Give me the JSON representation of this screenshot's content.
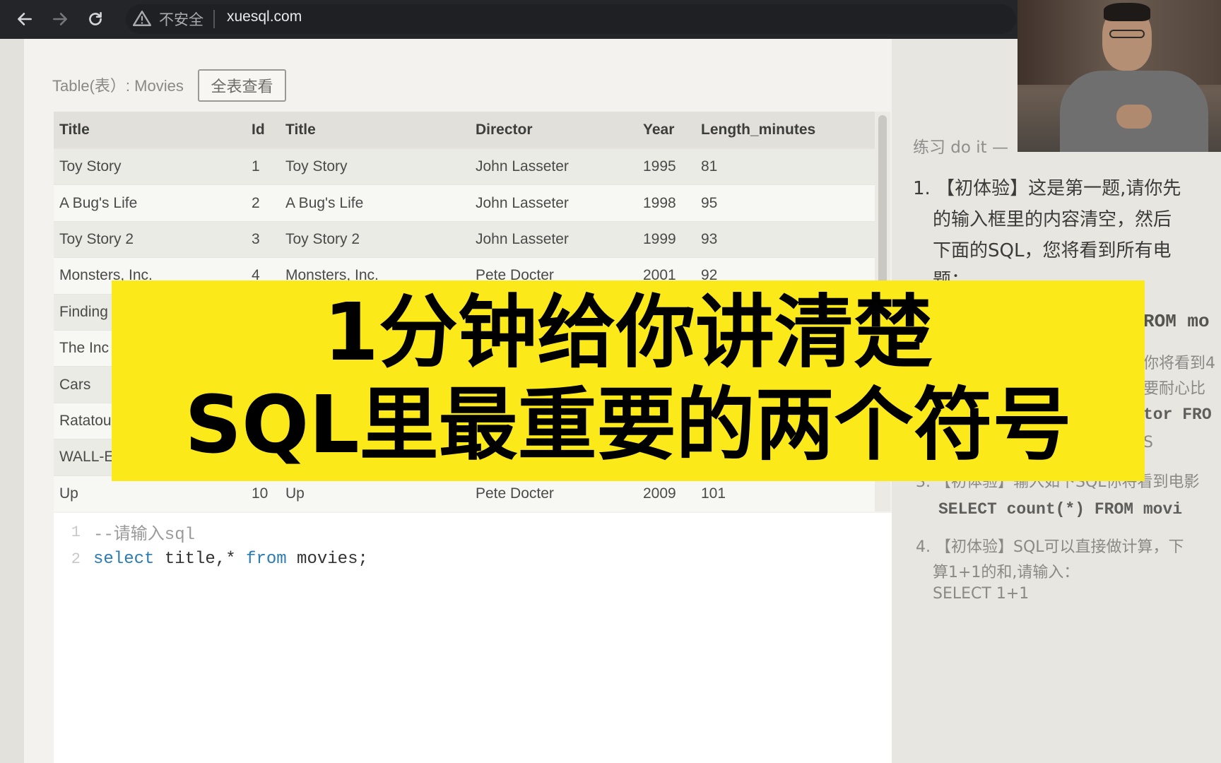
{
  "browser": {
    "security_label": "不安全",
    "url": "xuesql.com"
  },
  "table_section": {
    "caption": "Table(表）: Movies",
    "view_all_label": "全表查看",
    "columns": [
      "Title",
      "Id",
      "Title",
      "Director",
      "Year",
      "Length_minutes"
    ],
    "rows": [
      [
        "Toy Story",
        "1",
        "Toy Story",
        "John Lasseter",
        "1995",
        "81"
      ],
      [
        "A Bug's Life",
        "2",
        "A Bug's Life",
        "John Lasseter",
        "1998",
        "95"
      ],
      [
        "Toy Story 2",
        "3",
        "Toy Story 2",
        "John Lasseter",
        "1999",
        "93"
      ],
      [
        "Monsters, Inc.",
        "4",
        "Monsters, Inc.",
        "Pete Docter",
        "2001",
        "92"
      ],
      [
        "Finding",
        "",
        "",
        "",
        "",
        ""
      ],
      [
        "The Inc",
        "",
        "",
        "",
        "",
        ""
      ],
      [
        "Cars",
        "",
        "",
        "",
        "",
        ""
      ],
      [
        "Ratatou",
        "",
        "",
        "",
        "",
        ""
      ],
      [
        "WALL-E",
        "",
        "",
        "",
        "",
        ""
      ],
      [
        "Up",
        "10",
        "Up",
        "Pete Docter",
        "2009",
        "101"
      ]
    ]
  },
  "editor": {
    "lines": [
      {
        "number": "1",
        "comment": "--请输入sql"
      },
      {
        "number": "2",
        "keyword1": "select",
        "part1": " title,* ",
        "keyword2": "from",
        "part2": " movies;"
      }
    ]
  },
  "exercises": {
    "title": "练习 do it —",
    "item1_line1": "1. 【初体验】这是第一题,请你先",
    "item1_line2": "的输入框里的内容清空，然后",
    "item1_line3": "下面的SQL，您将看到所有电",
    "item1_line4": "题：",
    "code_fragment1": "ROM mo",
    "fragment2": "你将看到4",
    "fragment3": "要耐心比",
    "code_fragment2": "tor FRO",
    "fragment4": "S",
    "item3_line1": "3. 【初体验】输入如下SQL你将看到电影",
    "item3_code": "SELECT count(*) FROM movi",
    "item4_line1": "4. 【初体验】SQL可以直接做计算，下",
    "item4_line2": "算1+1的和,请输入：",
    "item4_line3": "SELECT 1+1"
  },
  "banner": {
    "line1": "1分钟给你讲清楚",
    "line2": "SQL里最重要的两个符号"
  },
  "colors": {
    "banner_bg": "#fbe91a",
    "keyword": "#2b7bb5",
    "topbar": "#242528"
  }
}
